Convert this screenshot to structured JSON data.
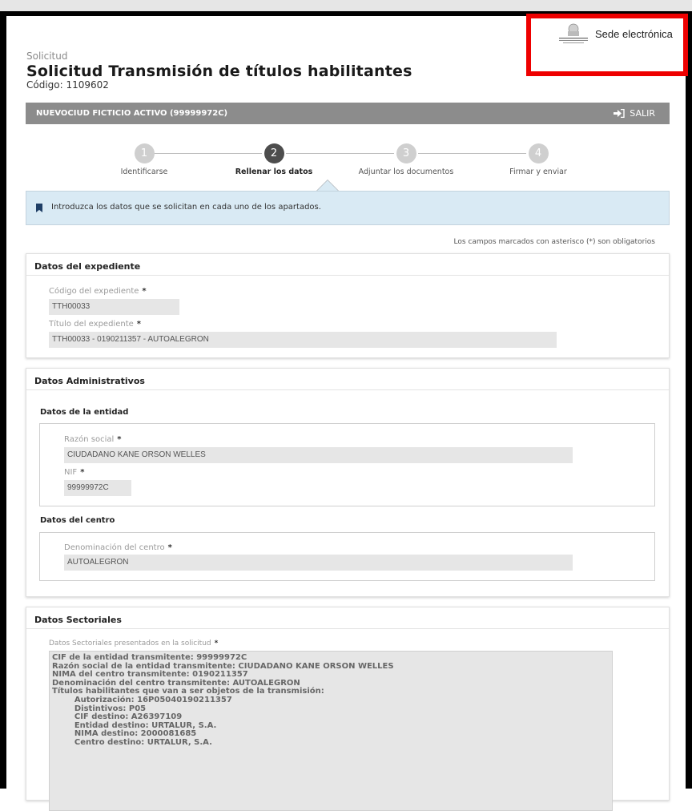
{
  "sede": {
    "label": "Sede electrónica",
    "logo_icon": "government-seal-icon"
  },
  "header": {
    "kicker": "Solicitud",
    "title": "Solicitud Transmisión de títulos habilitantes",
    "code": "Código: 1109602"
  },
  "userbar": {
    "user": "NUEVOCIUD FICTICIO ACTIVO (99999972C)",
    "logout_label": "SALIR",
    "logout_icon": "sign-out-icon"
  },
  "steps": [
    {
      "num": "1",
      "label": "Identificarse"
    },
    {
      "num": "2",
      "label": "Rellenar los datos"
    },
    {
      "num": "3",
      "label": "Adjuntar los documentos"
    },
    {
      "num": "4",
      "label": "Firmar y enviar"
    }
  ],
  "info": {
    "text": "Introduzca los datos que se solicitan en cada uno de los apartados.",
    "icon": "bookmark-icon"
  },
  "required_note": "Los campos marcados con asterisco (*) son obligatorios",
  "expediente": {
    "title": "Datos del expediente",
    "codigo_label": "Código del expediente",
    "codigo_value": "TTH00033",
    "titulo_label": "Título del expediente",
    "titulo_value": "TTH00033 - 0190211357 - AUTOALEGRON"
  },
  "administrativos": {
    "title": "Datos Administrativos",
    "entidad_title": "Datos de la entidad",
    "razon_label": "Razón social",
    "razon_value": "CIUDADANO KANE ORSON WELLES",
    "nif_label": "NIF",
    "nif_value": "99999972C",
    "centro_title": "Datos del centro",
    "denom_label": "Denominación del centro",
    "denom_value": "AUTOALEGRON"
  },
  "sectoriales": {
    "title": "Datos Sectoriales",
    "label": "Datos Sectoriales presentados en la solicitud",
    "text": "CIF de la entidad transmitente: 99999972C\nRazón social de la entidad transmitente: CIUDADANO KANE ORSON WELLES\nNIMA del centro transmitente: 0190211357\nDenominación del centro transmitente: AUTOALEGRON\nTítulos habilitantes que van a ser objetos de la transmisión:\n        Autorización: 16P05040190211357\n        Distintivos: P05\n        CIF destino: A26397109\n        Entidad destino: URTALUR, S.A.\n        NIMA destino: 2000081685\n        Centro destino: URTALUR, S.A."
  },
  "required_mark": "*"
}
